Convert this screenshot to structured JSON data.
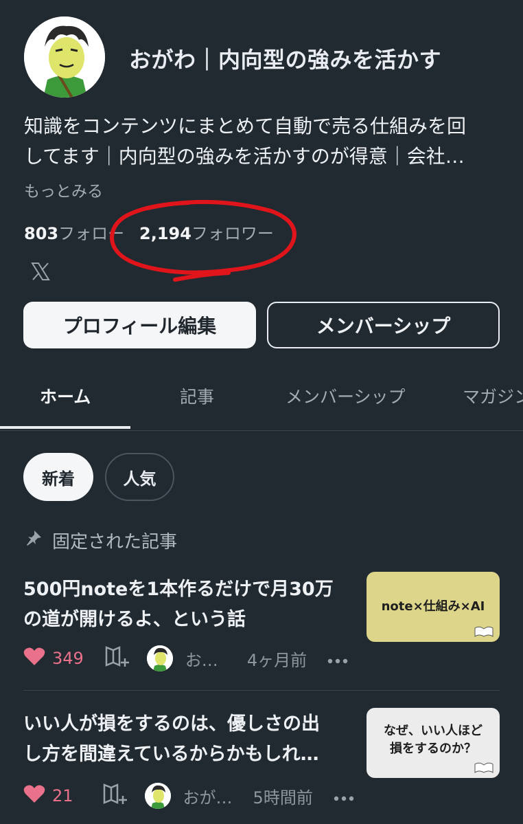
{
  "profile": {
    "name": "おがわ｜内向型の強みを活かす",
    "bio_line1": "知識をコンテンツにまとめて自動で売る仕組みを回",
    "bio_line2": "してます｜内向型の強みを活かすのが得意｜会社…",
    "more_label": "もっとみる",
    "following_count": "803",
    "following_label": "フォロー",
    "followers_count": "2,194",
    "followers_label": "フォロワー",
    "social_icon": "x-icon"
  },
  "buttons": {
    "edit_profile": "プロフィール編集",
    "membership": "メンバーシップ"
  },
  "tabs": [
    {
      "label": "ホーム",
      "active": true
    },
    {
      "label": "記事",
      "active": false
    },
    {
      "label": "メンバーシップ",
      "active": false
    },
    {
      "label": "マガジン",
      "active": false
    }
  ],
  "filters": {
    "new_label": "新着",
    "popular_label": "人気"
  },
  "pinned": {
    "label": "固定された記事",
    "icon": "pin-icon"
  },
  "articles": [
    {
      "title_line1": "500円noteを1本作るだけで月30万",
      "title_line2": "の道が開けるよ、という話",
      "thumb_text_line1": "note×仕組み×AI",
      "thumb_text_line2": "",
      "thumb_color": "#ddd68a",
      "likes": "349",
      "author": "お…",
      "time": "4ヶ月前"
    },
    {
      "title_line1": "いい人が損をするのは、優しさの出",
      "title_line2": "し方を間違えているからかもしれ…",
      "thumb_text_line1": "なぜ、いい人ほど",
      "thumb_text_line2": "損をするのか？",
      "thumb_color": "#ececec",
      "likes": "21",
      "author": "おが…",
      "time": "5時間前"
    }
  ],
  "colors": {
    "background": "#222a31",
    "like": "#e9718a",
    "annotation": "#e0151b"
  }
}
